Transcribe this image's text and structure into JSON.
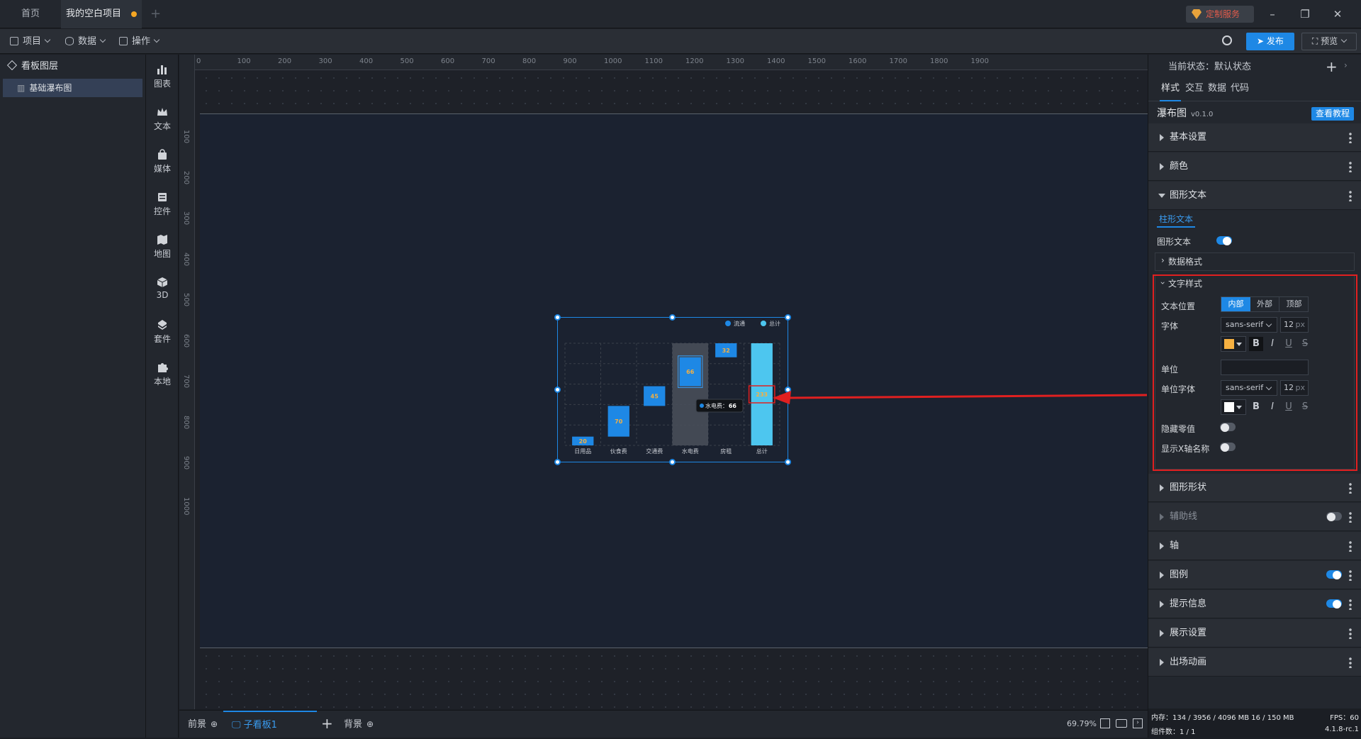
{
  "tabs": {
    "home": "首页",
    "project": "我的空白项目",
    "service": "定制服务"
  },
  "toolbar": {
    "project": "项目",
    "data": "数据",
    "ops": "操作",
    "publish": "发布",
    "preview": "预览"
  },
  "layers": {
    "title": "看板图层",
    "item": "基础瀑布图"
  },
  "iconbar": [
    "图表",
    "文本",
    "媒体",
    "控件",
    "地图",
    "3D",
    "套件",
    "本地"
  ],
  "ruler": {
    "top": [
      "0",
      "100",
      "200",
      "300",
      "400",
      "500",
      "600",
      "700",
      "800",
      "900",
      "1000",
      "1100",
      "1200",
      "1300",
      "1400",
      "1500",
      "1600",
      "1700",
      "1800",
      "1900"
    ],
    "left": [
      "100",
      "200",
      "300",
      "400",
      "500",
      "600",
      "700",
      "800",
      "900",
      "1000"
    ]
  },
  "chart_data": {
    "type": "bar",
    "categories": [
      "日用品",
      "伙食费",
      "交通费",
      "水电费",
      "房租",
      "总计"
    ],
    "series": [
      {
        "name": "流通",
        "values": [
          20,
          70,
          45,
          66,
          32,
          233
        ]
      },
      {
        "name": "总计",
        "values": [
          0,
          0,
          0,
          0,
          0,
          233
        ]
      }
    ],
    "data_labels": [
      "20",
      "70",
      "45",
      "66",
      "32",
      "233"
    ],
    "legend": [
      "流通",
      "总计"
    ],
    "tooltip": {
      "label": "水电费：",
      "value": "66"
    },
    "colors": {
      "bar": "#1e88e5",
      "total": "#4dc6ef",
      "label": "#f5b041"
    }
  },
  "bottombar": {
    "front": "前景",
    "sub": "子看板1",
    "back": "背景",
    "zoom": "69.79%"
  },
  "status": {
    "mem": "内存：134 / 3956 / 4096 MB  16 / 150 MB",
    "fps": "FPS：60",
    "count": "组件数：1 / 1",
    "version": "4.1.8-rc.1"
  },
  "rpanel": {
    "state_label": "当前状态：",
    "state_value": "默认状态",
    "tabs": [
      "样式",
      "交互",
      "数据",
      "代码"
    ],
    "comp_name": "瀑布图",
    "comp_ver": "v0.1.0",
    "tutorial": "查看教程",
    "sections": {
      "basic": "基本设置",
      "color": "颜色",
      "text": "图形文本",
      "shape": "图形形状",
      "guide": "辅助线",
      "axis": "轴",
      "legend": "图例",
      "tooltip": "提示信息",
      "display": "展示设置",
      "anim": "出场动画"
    },
    "subtab": "柱形文本",
    "text_toggle": "图形文本",
    "data_format": "数据格式",
    "text_style": "文字样式",
    "text_pos": "文本位置",
    "pos_opts": [
      "内部",
      "外部",
      "顶部"
    ],
    "font": "字体",
    "font_family": "sans-serif",
    "font_size": "12",
    "px": "px",
    "font_color": "#f5b041",
    "unit": "单位",
    "unit_font": "单位字体",
    "unit_font_family": "sans-serif",
    "unit_font_size": "12",
    "unit_color": "#ffffff",
    "hide_zero": "隐藏零值",
    "show_x": "显示X轴名称"
  }
}
